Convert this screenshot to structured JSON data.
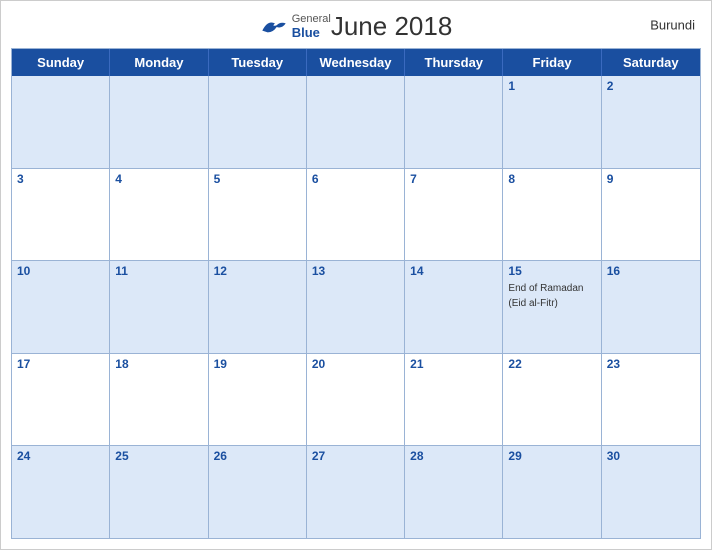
{
  "header": {
    "title": "June 2018",
    "country": "Burundi",
    "logo": {
      "general": "General",
      "blue": "Blue"
    }
  },
  "days_of_week": [
    "Sunday",
    "Monday",
    "Tuesday",
    "Wednesday",
    "Thursday",
    "Friday",
    "Saturday"
  ],
  "weeks": [
    [
      {
        "day": "",
        "empty": true
      },
      {
        "day": "",
        "empty": true
      },
      {
        "day": "",
        "empty": true
      },
      {
        "day": "",
        "empty": true
      },
      {
        "day": "",
        "empty": true
      },
      {
        "day": "1",
        "events": []
      },
      {
        "day": "2",
        "events": []
      }
    ],
    [
      {
        "day": "3",
        "events": []
      },
      {
        "day": "4",
        "events": []
      },
      {
        "day": "5",
        "events": []
      },
      {
        "day": "6",
        "events": []
      },
      {
        "day": "7",
        "events": []
      },
      {
        "day": "8",
        "events": []
      },
      {
        "day": "9",
        "events": []
      }
    ],
    [
      {
        "day": "10",
        "events": []
      },
      {
        "day": "11",
        "events": []
      },
      {
        "day": "12",
        "events": []
      },
      {
        "day": "13",
        "events": []
      },
      {
        "day": "14",
        "events": []
      },
      {
        "day": "15",
        "events": [
          "End of Ramadan (Eid al-Fitr)"
        ]
      },
      {
        "day": "16",
        "events": []
      }
    ],
    [
      {
        "day": "17",
        "events": []
      },
      {
        "day": "18",
        "events": []
      },
      {
        "day": "19",
        "events": []
      },
      {
        "day": "20",
        "events": []
      },
      {
        "day": "21",
        "events": []
      },
      {
        "day": "22",
        "events": []
      },
      {
        "day": "23",
        "events": []
      }
    ],
    [
      {
        "day": "24",
        "events": []
      },
      {
        "day": "25",
        "events": []
      },
      {
        "day": "26",
        "events": []
      },
      {
        "day": "27",
        "events": []
      },
      {
        "day": "28",
        "events": []
      },
      {
        "day": "29",
        "events": []
      },
      {
        "day": "30",
        "events": []
      }
    ]
  ]
}
